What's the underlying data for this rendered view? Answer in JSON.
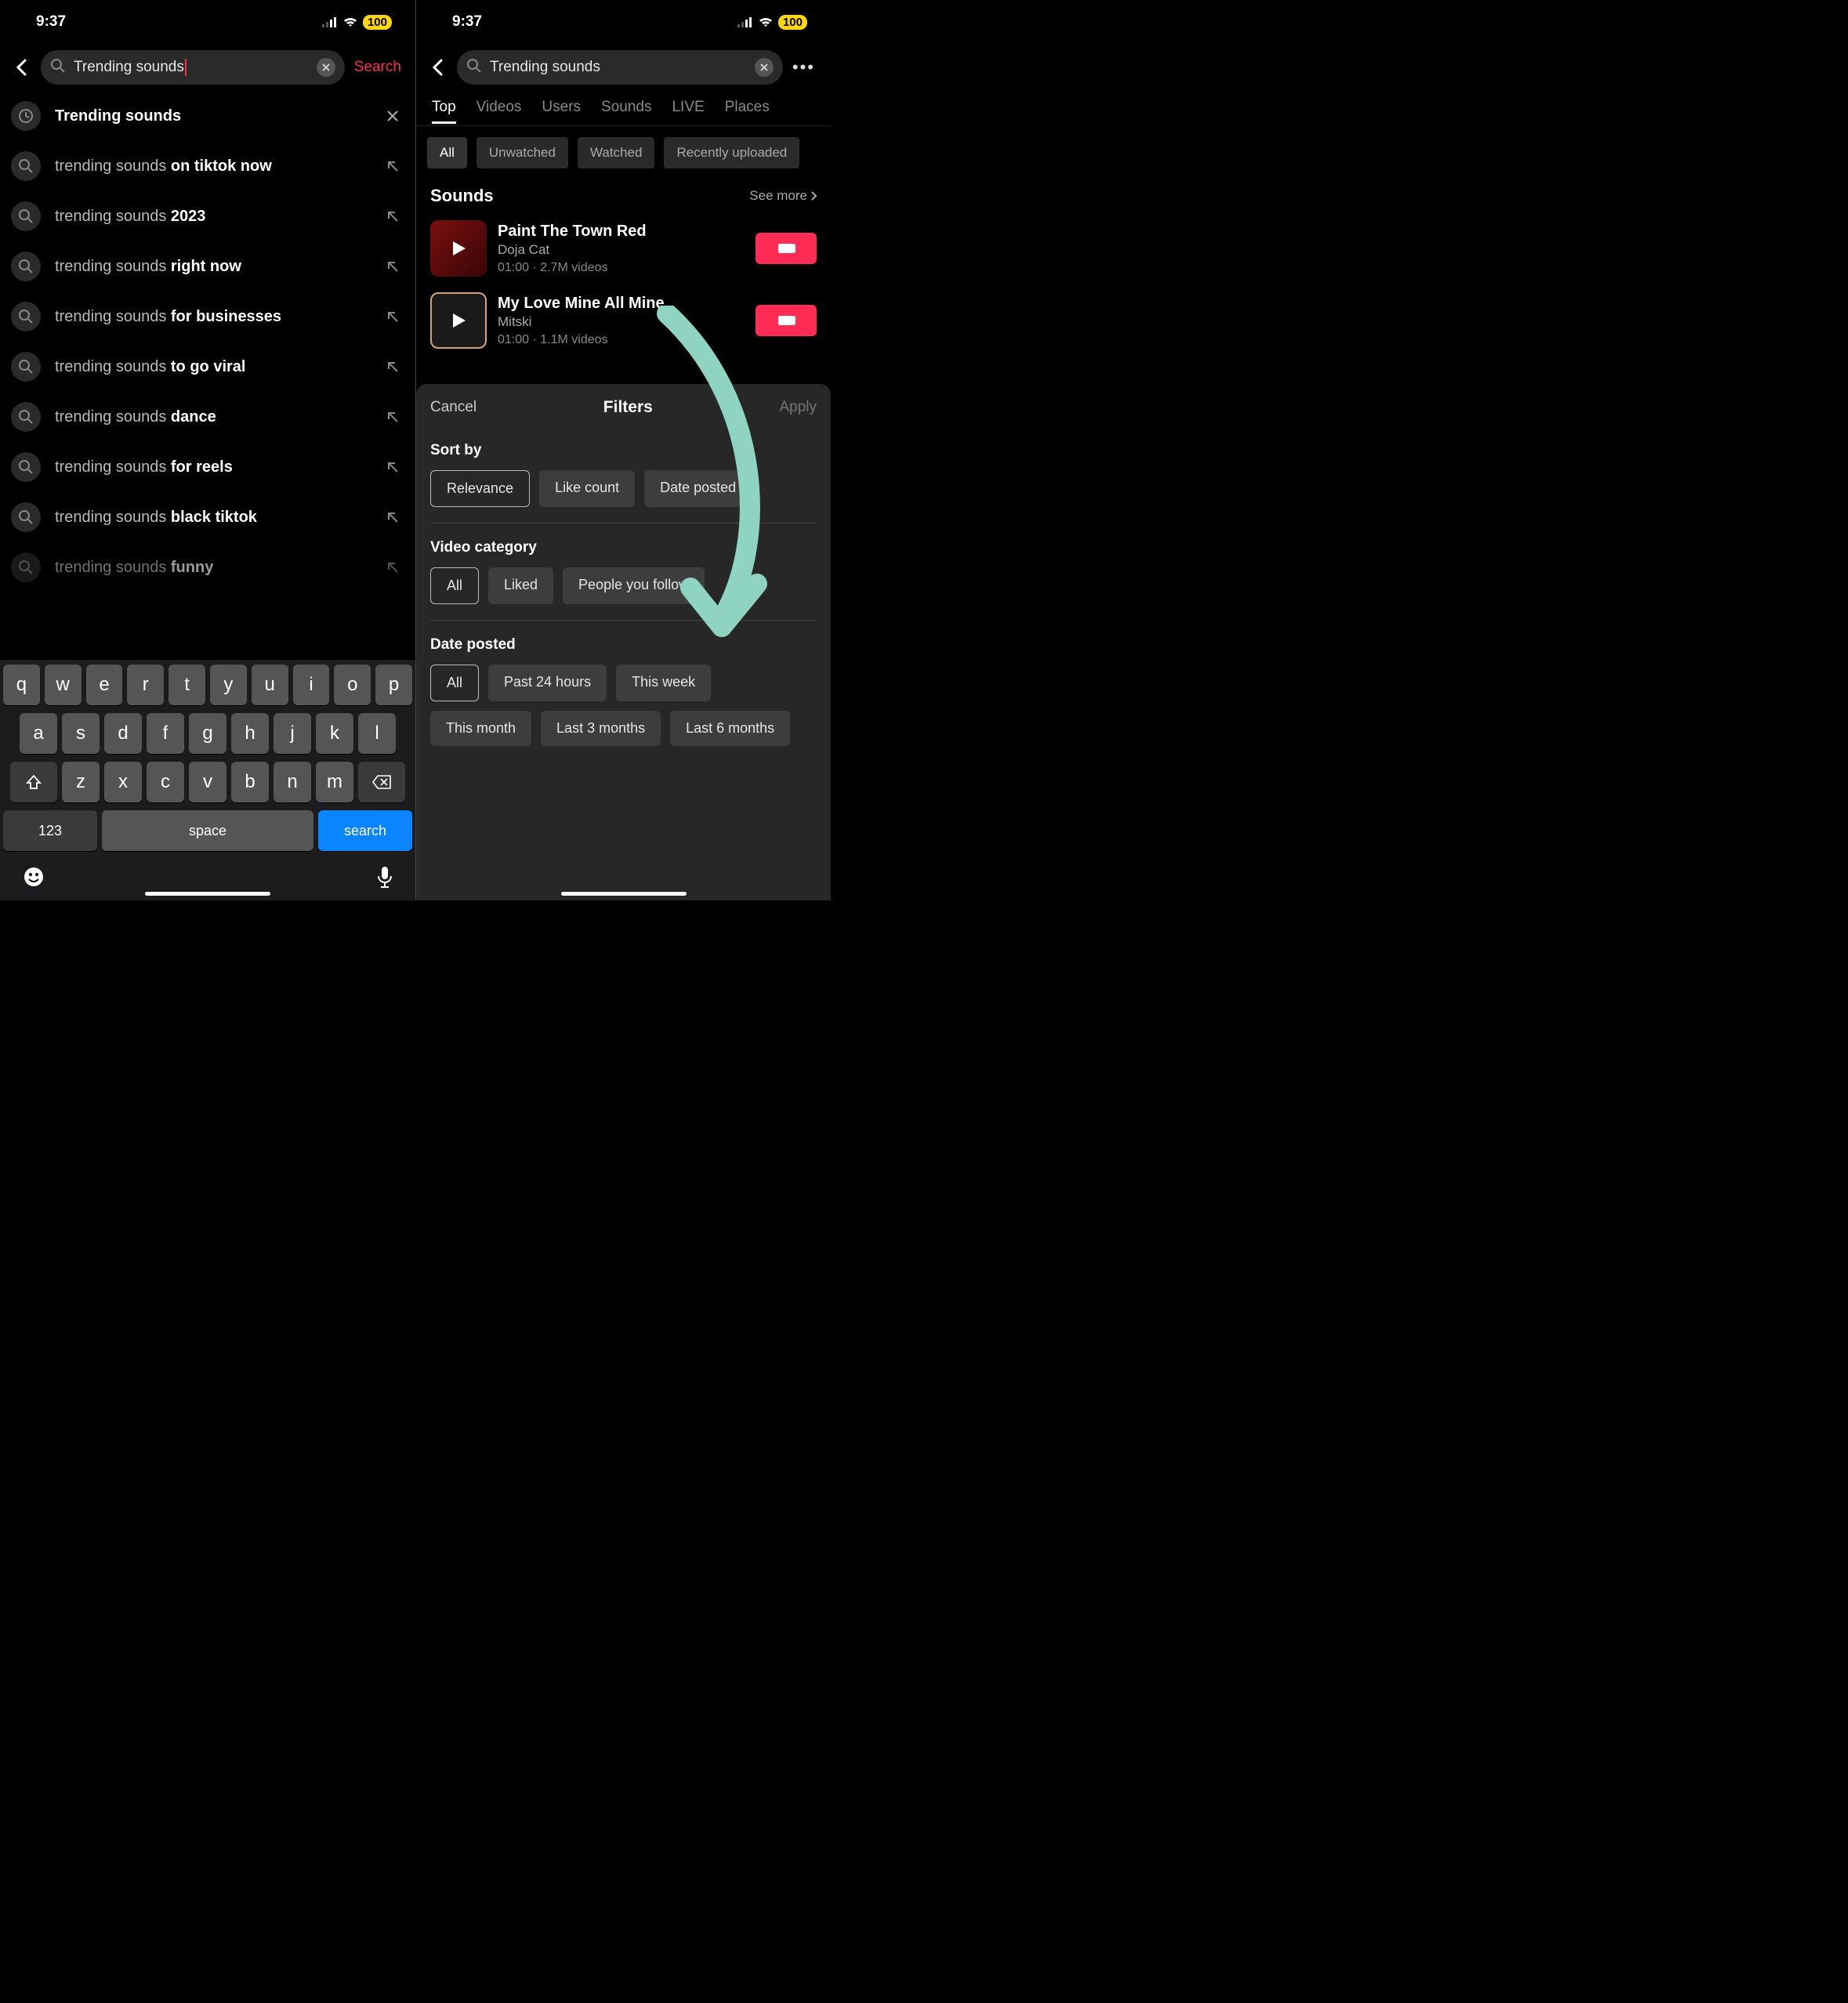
{
  "status": {
    "time": "9:37",
    "battery": "100"
  },
  "search": {
    "query": "Trending sounds",
    "action": "Search"
  },
  "suggestions": [
    {
      "prefix": "",
      "bold": "Trending sounds",
      "suffix": "",
      "first": true,
      "icon": "clock",
      "act": "x"
    },
    {
      "prefix": "trending sounds ",
      "bold": "on tiktok now",
      "suffix": ""
    },
    {
      "prefix": "trending sounds ",
      "bold": "2023",
      "suffix": ""
    },
    {
      "prefix": "trending sounds ",
      "bold": "right now",
      "suffix": ""
    },
    {
      "prefix": "trending sounds ",
      "bold": "for businesses",
      "suffix": ""
    },
    {
      "prefix": "trending sounds ",
      "bold": "to go viral",
      "suffix": ""
    },
    {
      "prefix": "trending sounds ",
      "bold": "dance",
      "suffix": ""
    },
    {
      "prefix": "trending sounds ",
      "bold": "for reels",
      "suffix": ""
    },
    {
      "prefix": "trending sounds ",
      "bold": "black tiktok",
      "suffix": ""
    },
    {
      "prefix": "trending sounds ",
      "bold": "funny",
      "suffix": "",
      "cut": true
    }
  ],
  "keyboard": {
    "row1": [
      "q",
      "w",
      "e",
      "r",
      "t",
      "y",
      "u",
      "i",
      "o",
      "p"
    ],
    "row2": [
      "a",
      "s",
      "d",
      "f",
      "g",
      "h",
      "j",
      "k",
      "l"
    ],
    "row3": [
      "z",
      "x",
      "c",
      "v",
      "b",
      "n",
      "m"
    ],
    "k123": "123",
    "space": "space",
    "search": "search"
  },
  "tabs": [
    "Top",
    "Videos",
    "Users",
    "Sounds",
    "LIVE",
    "Places"
  ],
  "watch_chips": [
    "All",
    "Unwatched",
    "Watched",
    "Recently uploaded"
  ],
  "sounds_section": {
    "title": "Sounds",
    "seemore": "See more"
  },
  "sounds": [
    {
      "title": "Paint The Town Red",
      "artist": "Doja Cat",
      "meta": "01:00 · 2.7M videos",
      "thumb": "red"
    },
    {
      "title": "My Love Mine All Mine",
      "artist": "Mitski",
      "meta": "01:00 · 1.1M videos",
      "thumb": "mitski"
    }
  ],
  "filters": {
    "cancel": "Cancel",
    "title": "Filters",
    "apply": "Apply",
    "sections": [
      {
        "name": "Sort by",
        "chips": [
          "Relevance",
          "Like count",
          "Date posted"
        ],
        "selected": 0
      },
      {
        "name": "Video category",
        "chips": [
          "All",
          "Liked",
          "People you follow"
        ],
        "selected": 0
      },
      {
        "name": "Date posted",
        "chips": [
          "All",
          "Past 24 hours",
          "This week",
          "This month",
          "Last 3 months",
          "Last 6 months"
        ],
        "selected": 0
      }
    ]
  }
}
